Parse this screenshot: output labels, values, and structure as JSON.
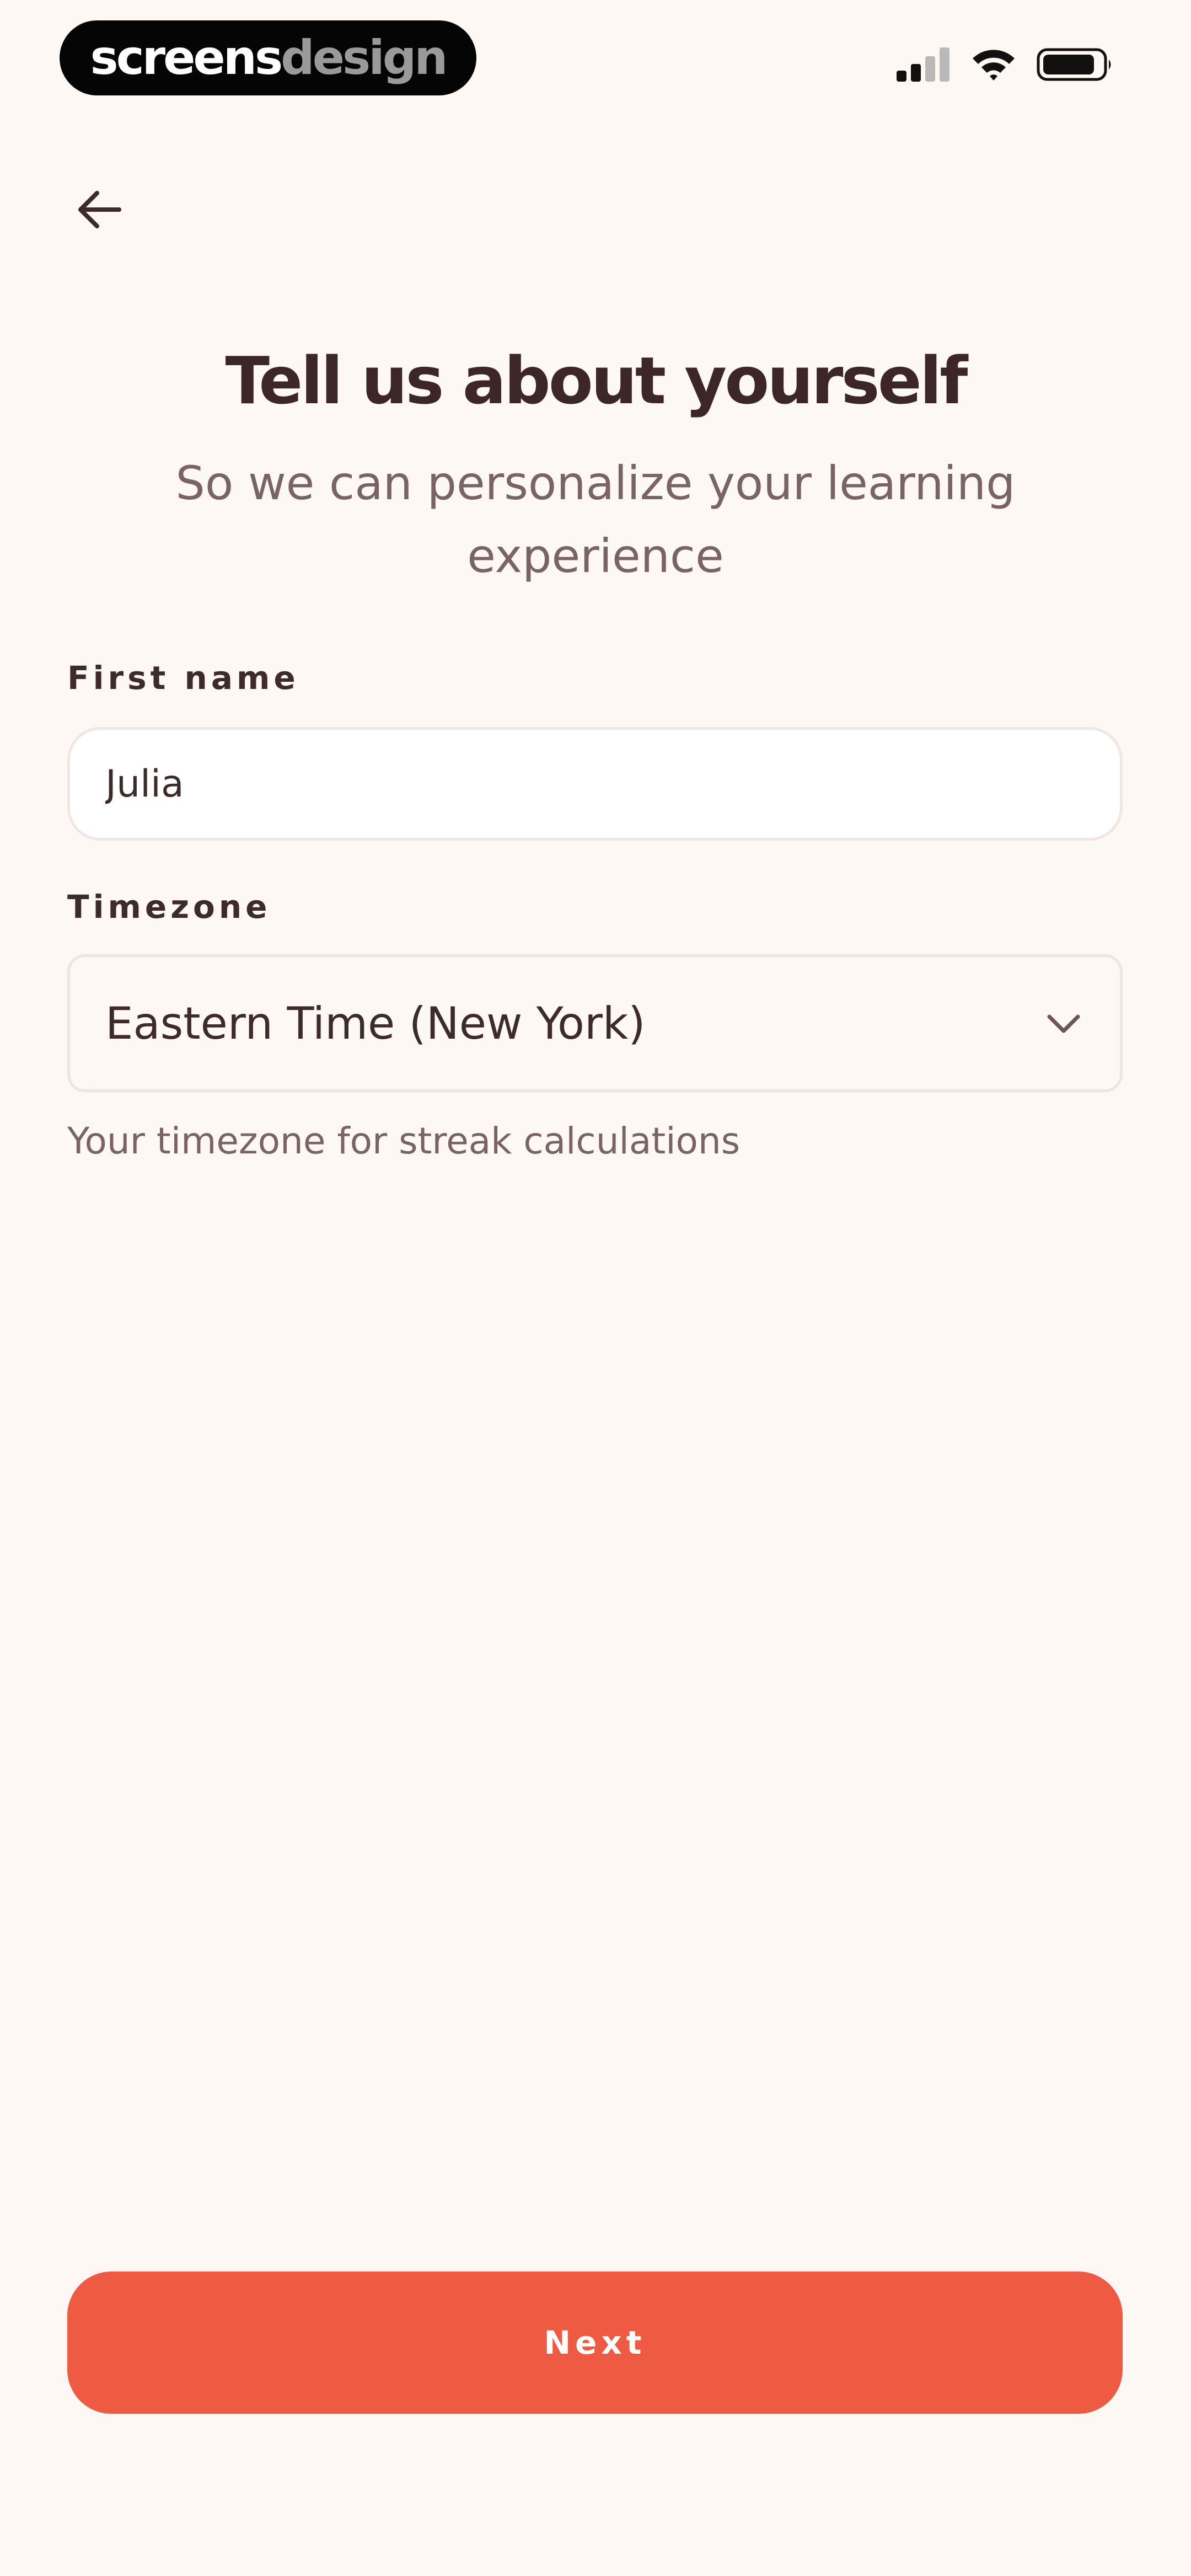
{
  "status_bar": {
    "brand_part1": "screens",
    "brand_part2": "design",
    "icons": [
      "cellular-signal-icon",
      "wifi-icon",
      "battery-icon"
    ]
  },
  "nav": {
    "back_icon": "arrow-left-icon"
  },
  "header": {
    "title": "Tell us about yourself",
    "subtitle": "So we can personalize your learning experience"
  },
  "form": {
    "first_name": {
      "label": "First name",
      "value": "Julia"
    },
    "timezone": {
      "label": "Timezone",
      "selected": "Eastern Time (New York)",
      "helper": "Your timezone for streak calculations",
      "icon": "chevron-down-icon"
    }
  },
  "footer": {
    "next_label": "Next"
  },
  "colors": {
    "background": "#fdf8f3",
    "accent": "#ef5a42",
    "text_primary": "#3d2b2b",
    "text_secondary": "#7a6363"
  }
}
